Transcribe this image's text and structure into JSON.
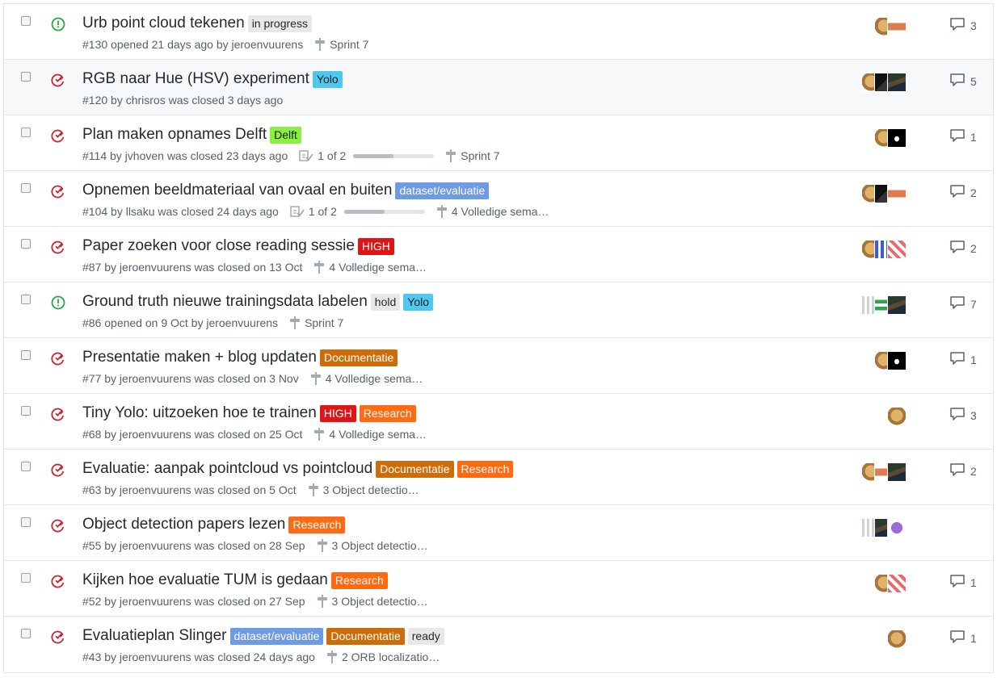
{
  "colors": {
    "open_state": "#28a745",
    "closed_state": "#cb2431"
  },
  "issues": [
    {
      "title": "Urb point cloud tekenen",
      "state": "open",
      "labels": [
        {
          "text": "in progress",
          "bg": "#e8e8e8",
          "fg": "#24292e"
        }
      ],
      "meta": "#130 opened 21 days ago by jeroenvuurens",
      "milestone": "Sprint 7",
      "comments": "3",
      "avatars": [
        "doge",
        "orange"
      ]
    },
    {
      "title": "RGB naar Hue (HSV) experiment",
      "state": "closed",
      "labels": [
        {
          "text": "Yolo",
          "bg": "#4fc8ef",
          "fg": "#1b1f23"
        }
      ],
      "meta": "#120 by chrisros was closed 3 days ago",
      "comments": "5",
      "avatars": [
        "doge",
        "dark",
        "photo"
      ]
    },
    {
      "title": "Plan maken opnames Delft",
      "state": "closed",
      "labels": [
        {
          "text": "Delft",
          "bg": "#8af23c",
          "fg": "#1b1f23"
        }
      ],
      "meta": "#114 by jvhoven was closed 23 days ago",
      "tasks": "1 of 2",
      "milestone": "Sprint 7",
      "comments": "1",
      "avatars": [
        "doge",
        "black"
      ]
    },
    {
      "title": "Opnemen beeldmateriaal van ovaal en buiten",
      "state": "closed",
      "labels": [
        {
          "text": "dataset/evaluatie",
          "bg": "#6f9ae6",
          "fg": "#ffffff"
        }
      ],
      "meta": "#104 by llsaku was closed 24 days ago",
      "tasks": "1 of 2",
      "milestone": "4 Volledige sema…",
      "comments": "2",
      "avatars": [
        "doge",
        "dark",
        "orange"
      ]
    },
    {
      "title": "Paper zoeken voor close reading sessie",
      "state": "closed",
      "labels": [
        {
          "text": "HIGH",
          "bg": "#e01414",
          "fg": "#ffffff"
        }
      ],
      "meta": "#87 by jeroenvuurens was closed on 13 Oct",
      "milestone": "4 Volledige sema…",
      "comments": "2",
      "avatars": [
        "doge",
        "blue",
        "pattern"
      ]
    },
    {
      "title": "Ground truth nieuwe trainingsdata labelen",
      "state": "open",
      "labels": [
        {
          "text": "hold",
          "bg": "#e8e8e8",
          "fg": "#24292e"
        },
        {
          "text": "Yolo",
          "bg": "#4fc8ef",
          "fg": "#1b1f23"
        }
      ],
      "meta": "#86 opened on 9 Oct by jeroenvuurens",
      "milestone": "Sprint 7",
      "comments": "7",
      "avatars": [
        "gray",
        "green",
        "photo"
      ]
    },
    {
      "title": "Presentatie maken + blog updaten",
      "state": "closed",
      "labels": [
        {
          "text": "Documentatie",
          "bg": "#cc6d09",
          "fg": "#ffffff"
        }
      ],
      "meta": "#77 by jeroenvuurens was closed on 3 Nov",
      "milestone": "4 Volledige sema…",
      "comments": "1",
      "avatars": [
        "doge",
        "black"
      ]
    },
    {
      "title": "Tiny Yolo: uitzoeken hoe te trainen",
      "state": "closed",
      "labels": [
        {
          "text": "HIGH",
          "bg": "#e01414",
          "fg": "#ffffff"
        },
        {
          "text": "Research",
          "bg": "#ff6a13",
          "fg": "#ffffff"
        }
      ],
      "meta": "#68 by jeroenvuurens was closed on 25 Oct",
      "milestone": "4 Volledige sema…",
      "comments": "3",
      "avatars": [
        "doge"
      ]
    },
    {
      "title": "Evaluatie: aanpak pointcloud vs pointcloud",
      "state": "closed",
      "labels": [
        {
          "text": "Documentatie",
          "bg": "#cc6d09",
          "fg": "#ffffff"
        },
        {
          "text": "Research",
          "bg": "#ff6a13",
          "fg": "#ffffff"
        }
      ],
      "meta": "#63 by jeroenvuurens was closed on 5 Oct",
      "milestone": "3 Object detectio…",
      "comments": "2",
      "avatars": [
        "doge",
        "orange",
        "photo"
      ]
    },
    {
      "title": "Object detection papers lezen",
      "state": "closed",
      "labels": [
        {
          "text": "Research",
          "bg": "#ff6a13",
          "fg": "#ffffff"
        }
      ],
      "meta": "#55 by jeroenvuurens was closed on 28 Sep",
      "milestone": "3 Object detectio…",
      "comments": "",
      "avatars": [
        "gray",
        "photo",
        "purple"
      ]
    },
    {
      "title": "Kijken hoe evaluatie TUM is gedaan",
      "state": "closed",
      "labels": [
        {
          "text": "Research",
          "bg": "#ff6a13",
          "fg": "#ffffff"
        }
      ],
      "meta": "#52 by jeroenvuurens was closed on 27 Sep",
      "milestone": "3 Object detectio…",
      "comments": "1",
      "avatars": [
        "doge",
        "pattern"
      ]
    },
    {
      "title": "Evaluatieplan Slinger",
      "state": "closed",
      "labels": [
        {
          "text": "dataset/evaluatie",
          "bg": "#6f9ae6",
          "fg": "#ffffff"
        },
        {
          "text": "Documentatie",
          "bg": "#cc6d09",
          "fg": "#ffffff"
        },
        {
          "text": "ready",
          "bg": "#e8e8e8",
          "fg": "#24292e"
        }
      ],
      "meta": "#43 by jeroenvuurens was closed 24 days ago",
      "milestone": "2 ORB localizatio…",
      "comments": "1",
      "avatars": [
        "doge"
      ]
    }
  ]
}
